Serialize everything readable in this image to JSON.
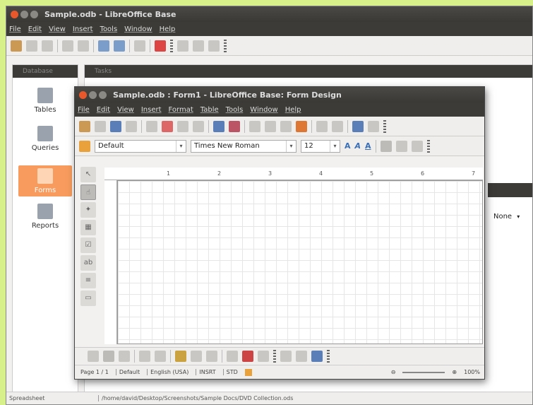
{
  "main_window": {
    "title": "Sample.odb - LibreOffice Base",
    "menu": [
      "File",
      "Edit",
      "View",
      "Insert",
      "Tools",
      "Window",
      "Help"
    ],
    "database_header": "Database",
    "tasks_header": "Tasks",
    "db_items": [
      {
        "label": "Tables",
        "icon": "tables-icon"
      },
      {
        "label": "Queries",
        "icon": "queries-icon"
      },
      {
        "label": "Forms",
        "icon": "forms-icon"
      },
      {
        "label": "Reports",
        "icon": "reports-icon"
      }
    ],
    "none_dropdown": "None",
    "status_left": "Spreadsheet",
    "status_path": "/home/david/Desktop/Screenshots/Sample Docs/DVD Collection.ods"
  },
  "form_window": {
    "title": "Sample.odb : Form1 - LibreOffice Base: Form Design",
    "menu": [
      "File",
      "Edit",
      "View",
      "Insert",
      "Format",
      "Table",
      "Tools",
      "Window",
      "Help"
    ],
    "style_value": "Default",
    "font_value": "Times New Roman",
    "size_value": "12",
    "ruler_marks": [
      "1",
      "2",
      "3",
      "4",
      "5",
      "6",
      "7"
    ],
    "status": {
      "page": "Page 1 / 1",
      "style": "Default",
      "language": "English (USA)",
      "insert": "INSRT",
      "selection": "STD",
      "zoom": "100%"
    }
  },
  "colors": {
    "background": "#d7f08a",
    "accent": "#f79c5e",
    "dark_bar": "#3c3b37"
  }
}
